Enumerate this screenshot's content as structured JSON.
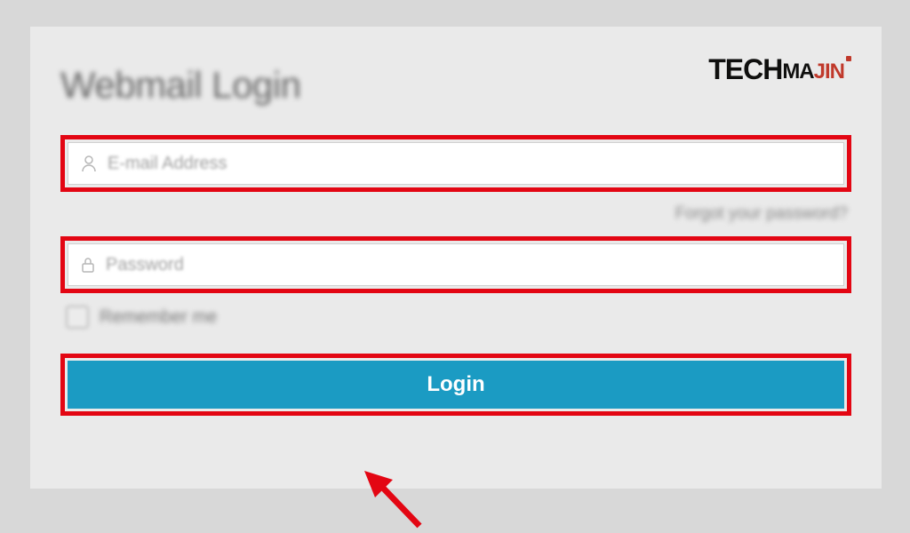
{
  "brand": {
    "part1": "TECH",
    "part2": "MA",
    "part3": "JIN"
  },
  "title": "Webmail Login",
  "email": {
    "placeholder": "E-mail Address",
    "value": ""
  },
  "password": {
    "placeholder": "Password",
    "value": ""
  },
  "forgot_label": "Forgot your password?",
  "remember_label": "Remember me",
  "login_label": "Login",
  "colors": {
    "accent": "#1b9bc3",
    "highlight": "#e30613",
    "brand_red": "#c0392b"
  }
}
